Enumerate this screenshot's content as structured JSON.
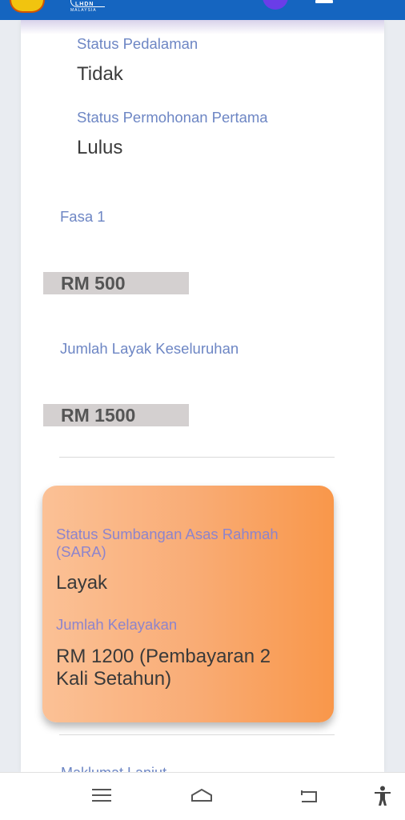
{
  "header": {
    "logo_text_top": "LHDN",
    "logo_text_bottom": "MALAYSIA"
  },
  "main": {
    "status_pedalaman_label": "Status Pedalaman",
    "status_pedalaman_value": "Tidak",
    "status_permohonan_label": "Status Permohonan Pertama",
    "status_permohonan_value": "Lulus",
    "fasa_label": "Fasa 1",
    "fasa_amount": "RM 500",
    "jumlah_label": "Jumlah Layak Keseluruhan",
    "jumlah_amount": "RM 1500"
  },
  "sara": {
    "status_label": "Status Sumbangan Asas Rahmah (SARA)",
    "status_value": "Layak",
    "jumlah_label": "Jumlah Kelayakan",
    "jumlah_value": "RM 1200 (Pembayaran 2 Kali Setahun)"
  },
  "cut_off_text": "Maklumat Lanjut"
}
